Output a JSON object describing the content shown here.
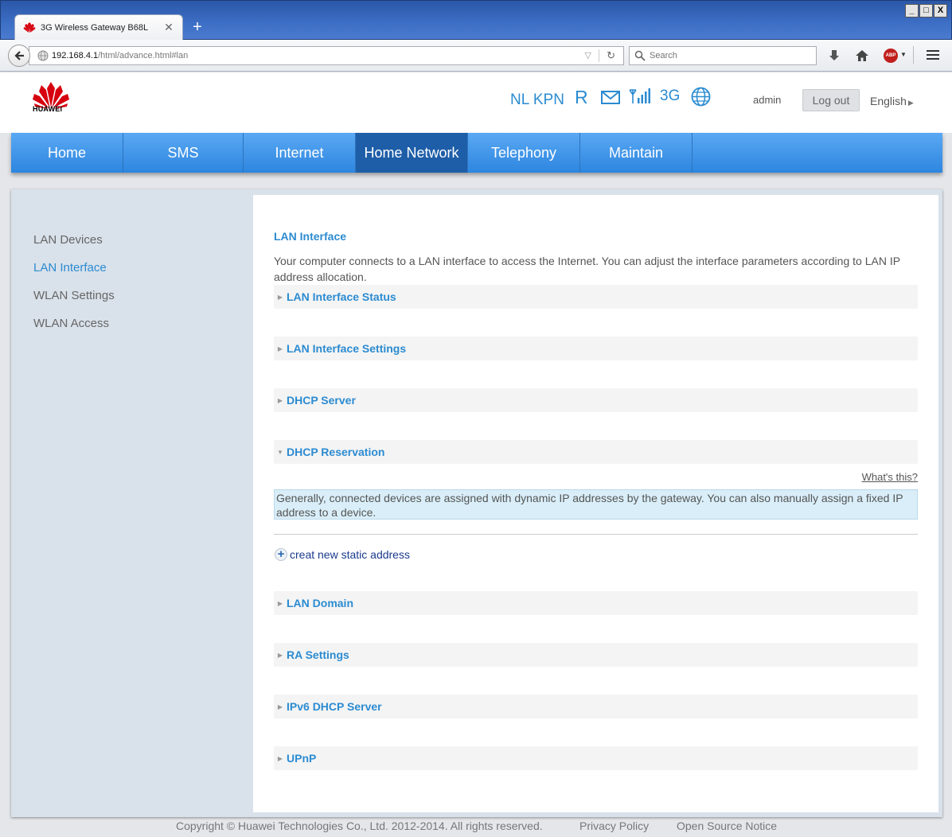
{
  "browser": {
    "tab_title": "3G Wireless Gateway B68L",
    "tab_close": "✕",
    "new_tab": "+",
    "window_buttons": [
      "_",
      "□",
      "X"
    ],
    "url_host": "192.168.4.1",
    "url_path": "/html/advance.html#lan",
    "search_placeholder": "Search"
  },
  "header": {
    "brand": "HUAWEI",
    "operator": "NL KPN",
    "roaming": "R",
    "network_type": "3G",
    "user": "admin",
    "logout_label": "Log out",
    "language": "English"
  },
  "nav": {
    "items": [
      {
        "label": "Home"
      },
      {
        "label": "SMS"
      },
      {
        "label": "Internet"
      },
      {
        "label": "Home Network",
        "active": true
      },
      {
        "label": "Telephony"
      },
      {
        "label": "Maintain"
      }
    ]
  },
  "sidebar": {
    "items": [
      {
        "label": "LAN Devices"
      },
      {
        "label": "LAN Interface",
        "active": true
      },
      {
        "label": "WLAN Settings"
      },
      {
        "label": "WLAN Access"
      }
    ]
  },
  "panel": {
    "title": "LAN Interface",
    "description": "Your computer connects to a LAN interface to access the Internet. You can adjust the interface parameters according to LAN IP address allocation.",
    "sections": [
      {
        "label": "LAN Interface Status",
        "expanded": false
      },
      {
        "label": "LAN Interface Settings",
        "expanded": false
      },
      {
        "label": "DHCP Server",
        "expanded": false
      },
      {
        "label": "DHCP Reservation",
        "expanded": true
      },
      {
        "label": "LAN Domain",
        "expanded": false
      },
      {
        "label": "RA Settings",
        "expanded": false
      },
      {
        "label": "IPv6 DHCP Server",
        "expanded": false
      },
      {
        "label": "UPnP",
        "expanded": false
      }
    ],
    "whats_this": "What's this?",
    "reservation_info": "Generally, connected devices are assigned with dynamic IP addresses by the gateway. You can also manually assign a fixed IP address to a device.",
    "add_static_label": "creat new static address"
  },
  "footer": {
    "copyright": "Copyright © Huawei Technologies Co., Ltd. 2012-2014. All rights reserved.",
    "privacy": "Privacy Policy",
    "open_source": "Open Source Notice"
  },
  "colors": {
    "accent": "#2b8bd1",
    "nav_gradient_top": "#5aa8f3",
    "nav_active": "#1e5ea8",
    "info_box": "#d9eef8",
    "brand_red": "#d6000f"
  },
  "icons": {
    "tab_favicon": "huawei-logo-icon",
    "back": "back-arrow-icon",
    "site_identity": "globe-icon",
    "search": "search-icon",
    "download": "download-arrow-icon",
    "home": "home-icon",
    "adblock": "abp-icon",
    "menu": "hamburger-menu-icon",
    "mail": "mail-icon",
    "signal": "signal-bars-icon",
    "internet": "globe-icon"
  }
}
